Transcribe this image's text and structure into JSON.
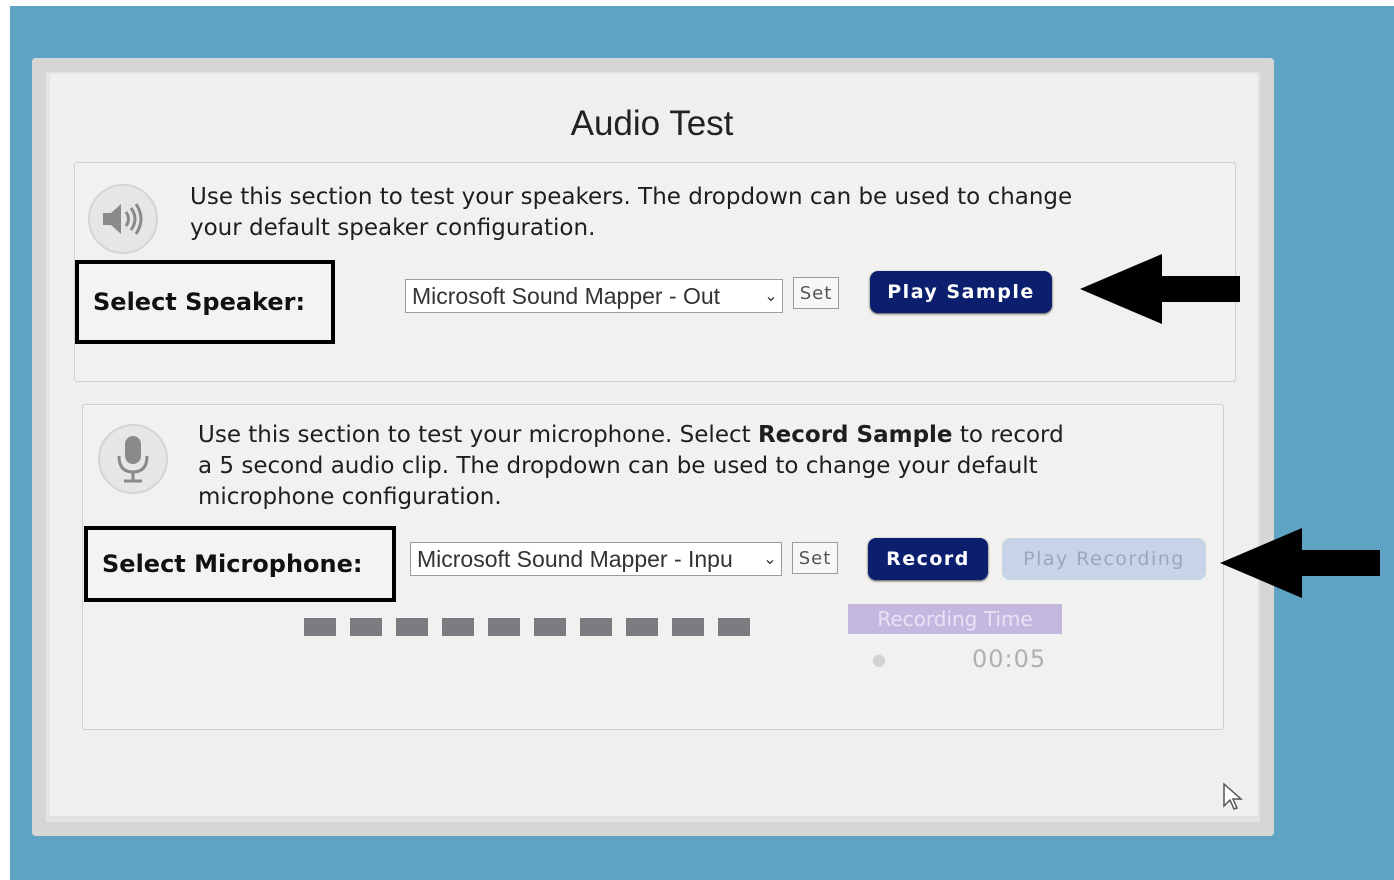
{
  "window": {
    "title": "Audio Test"
  },
  "speaker": {
    "description": "Use this section to test your speakers. The dropdown can be used to change your default speaker configuration.",
    "label": "Select Speaker:",
    "dropdown_value": "Microsoft Sound Mapper - Out",
    "set_label": "Set",
    "play_label": "Play Sample",
    "icon": "speaker-icon"
  },
  "microphone": {
    "description_pre": "Use this section to test your microphone. Select ",
    "description_bold": "Record Sample",
    "description_post": " to record a 5 second audio clip. The dropdown can be used to change your default microphone configuration.",
    "label": "Select Microphone:",
    "dropdown_value": "Microsoft Sound Mapper - Inpu",
    "set_label": "Set",
    "record_label": "Record",
    "play_recording_label": "Play Recording",
    "recording_time_label": "Recording Time",
    "recording_time_value": "00:05",
    "level_segments": 10,
    "icon": "microphone-icon"
  },
  "colors": {
    "primary_button": "#0b1f6e",
    "disabled_button": "#c7d4e8",
    "background": "#5fa3c4"
  }
}
